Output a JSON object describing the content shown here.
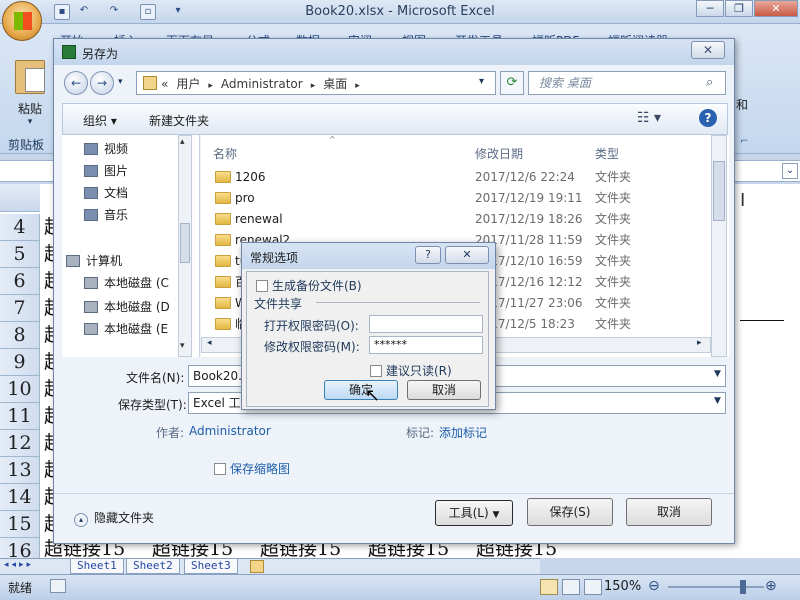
{
  "excel": {
    "title": "Book20.xlsx - Microsoft Excel",
    "tabs": [
      "开始",
      "插入",
      "页面布局",
      "公式",
      "数据",
      "审阅",
      "视图",
      "开发工具",
      "福昕PDF",
      "福昕阅读器"
    ],
    "paste_label": "粘贴",
    "clipboard_group": "剪贴板",
    "ribbon_right_label": "和",
    "rows": [
      "4",
      "5",
      "6",
      "7",
      "8",
      "9",
      "10",
      "11",
      "12",
      "13",
      "14",
      "15",
      "16"
    ],
    "cell_stub": "超",
    "row16_cells": [
      "超链接15",
      "超链接15",
      "超链接15",
      "超链接15",
      "超链接15"
    ],
    "sheet_tabs": [
      "Sheet1",
      "Sheet2",
      "Sheet3"
    ],
    "status": "就绪",
    "zoom": "150%"
  },
  "save_dialog": {
    "title": "另存为",
    "breadcrumb": [
      "«",
      "用户",
      "Administrator",
      "桌面"
    ],
    "search_placeholder": "搜索 桌面",
    "organize": "组织 ▾",
    "new_folder": "新建文件夹",
    "nav_items": [
      {
        "label": "视频",
        "icon": "video-icon"
      },
      {
        "label": "图片",
        "icon": "picture-icon"
      },
      {
        "label": "文档",
        "icon": "document-icon"
      },
      {
        "label": "音乐",
        "icon": "music-icon"
      },
      {
        "label": "计算机",
        "icon": "computer-icon"
      },
      {
        "label": "本地磁盘 (C",
        "icon": "drive-icon"
      },
      {
        "label": "本地磁盘 (D",
        "icon": "drive-icon"
      },
      {
        "label": "本地磁盘 (E",
        "icon": "drive-icon"
      }
    ],
    "columns": {
      "name": "名称",
      "date": "修改日期",
      "type": "类型"
    },
    "files": [
      {
        "name": "1206",
        "date": "2017/12/6 22:24",
        "type": "文件夹"
      },
      {
        "name": "pro",
        "date": "2017/12/19 19:11",
        "type": "文件夹"
      },
      {
        "name": "renewal",
        "date": "2017/12/19 18:26",
        "type": "文件夹"
      },
      {
        "name": "renewal2",
        "date": "2017/11/28 11:59",
        "type": "文件夹"
      },
      {
        "name": "tu",
        "date": "2017/12/10 16:59",
        "type": "文件夹"
      },
      {
        "name": "百",
        "date": "2017/12/16 12:12",
        "type": "文件夹"
      },
      {
        "name": "Wo",
        "date": "2017/11/27 23:06",
        "type": "文件夹"
      },
      {
        "name": "临",
        "date": "2017/12/5 18:23",
        "type": "文件夹"
      }
    ],
    "filename_label": "文件名(N):",
    "filename_value": "Book20.x",
    "filetype_label": "保存类型(T):",
    "filetype_value": "Excel 工作",
    "author_label": "作者:",
    "author_value": "Administrator",
    "tags_label": "标记:",
    "tags_value": "添加标记",
    "thumbnail_label": "保存缩略图",
    "hide_folders": "隐藏文件夹",
    "tools_button": "工具(L)",
    "save_button": "保存(S)",
    "cancel_button": "取消"
  },
  "options_dialog": {
    "title": "常规选项",
    "help": "?",
    "backup_label": "生成备份文件(B)",
    "sharing_group": "文件共享",
    "open_pw_label": "打开权限密码(O):",
    "open_pw_value": "",
    "modify_pw_label": "修改权限密码(M):",
    "modify_pw_value": "******",
    "readonly_label": "建议只读(R)",
    "ok_button": "确定",
    "cancel_button": "取消"
  }
}
